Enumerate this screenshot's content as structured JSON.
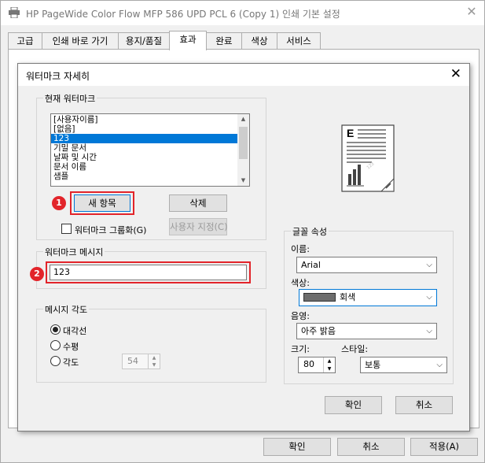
{
  "outer_window": {
    "title": "HP PageWide Color Flow MFP 586 UPD PCL 6 (Copy 1) 인쇄 기본 설정",
    "close_glyph": "✕",
    "tabs": [
      {
        "label": "고급"
      },
      {
        "label": "인쇄 바로 가기"
      },
      {
        "label": "용지/품질"
      },
      {
        "label": "효과"
      },
      {
        "label": "완료"
      },
      {
        "label": "색상"
      },
      {
        "label": "서비스"
      }
    ],
    "active_tab": "효과",
    "buttons": {
      "ok": "확인",
      "cancel": "취소",
      "apply": "적용(A)"
    }
  },
  "dialog": {
    "title": "워터마크 자세히",
    "close_glyph": "✕",
    "current_watermark": {
      "group_label": "현재 워터마크",
      "items": [
        "[사용자이름]",
        "[없음]",
        "123",
        "기밀 문서",
        "날짜 및 시간",
        "문서 이름",
        "샘플"
      ],
      "selected": "123",
      "new_button": "새 항목",
      "delete_button": "삭제",
      "group_checkbox_label": "워터마크 그룹화(G)",
      "group_checkbox_checked": false,
      "custom_button": "사용자 지정(C)"
    },
    "message": {
      "group_label": "워터마크 메시지",
      "value": "123"
    },
    "angle": {
      "group_label": "메시지 각도",
      "options": [
        {
          "label": "대각선",
          "checked": true
        },
        {
          "label": "수평",
          "checked": false
        },
        {
          "label": "각도",
          "checked": false
        }
      ],
      "angle_value": "54"
    },
    "font": {
      "group_label": "글꼴 속성",
      "name_label": "이름:",
      "name_value": "Arial",
      "color_label": "색상:",
      "color_value": "회색",
      "color_swatch": "#6d6d6d",
      "shading_label": "음영:",
      "shading_value": "아주 밝음",
      "size_label": "크기:",
      "size_value": "80",
      "style_label": "스타일:",
      "style_value": "보통"
    },
    "buttons": {
      "ok": "확인",
      "cancel": "취소"
    },
    "annotations": {
      "badge1": "1",
      "badge2": "2"
    },
    "highlight_color": "#e2242a",
    "selection_color": "#0078d7"
  }
}
